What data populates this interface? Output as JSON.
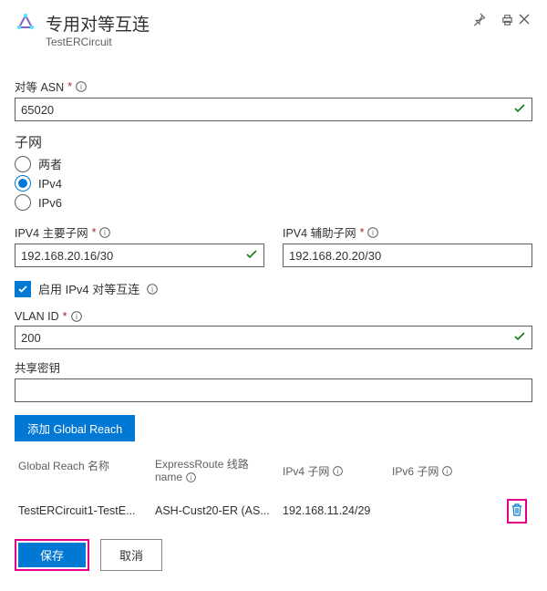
{
  "header": {
    "title": "专用对等互连",
    "subtitle": "TestERCircuit"
  },
  "fields": {
    "peer_asn": {
      "label": "对等 ASN",
      "value": "65020"
    },
    "subnet_section": "子网",
    "radios": {
      "both": "两者",
      "ipv4": "IPv4",
      "ipv6": "IPv6"
    },
    "ipv4_primary": {
      "label": "IPV4 主要子网",
      "value": "192.168.20.16/30"
    },
    "ipv4_secondary": {
      "label": "IPV4 辅助子网",
      "value": "192.168.20.20/30"
    },
    "enable_ipv4": "启用 IPv4 对等互连",
    "vlan_id": {
      "label": "VLAN ID",
      "value": "200"
    },
    "shared_key": {
      "label": "共享密钥",
      "value": ""
    },
    "add_global_reach": "添加 Global Reach"
  },
  "table": {
    "headers": {
      "name": "Global Reach 名称",
      "circuit_top": "ExpressRoute 线路",
      "circuit_bottom": "name",
      "ipv4": "IPv4 子网",
      "ipv6": "IPv6 子网"
    },
    "rows": [
      {
        "name": "TestERCircuit1-TestE...",
        "circuit": "ASH-Cust20-ER (AS...",
        "ipv4": "192.168.11.24/29",
        "ipv6": ""
      }
    ]
  },
  "footer": {
    "save": "保存",
    "cancel": "取消"
  }
}
